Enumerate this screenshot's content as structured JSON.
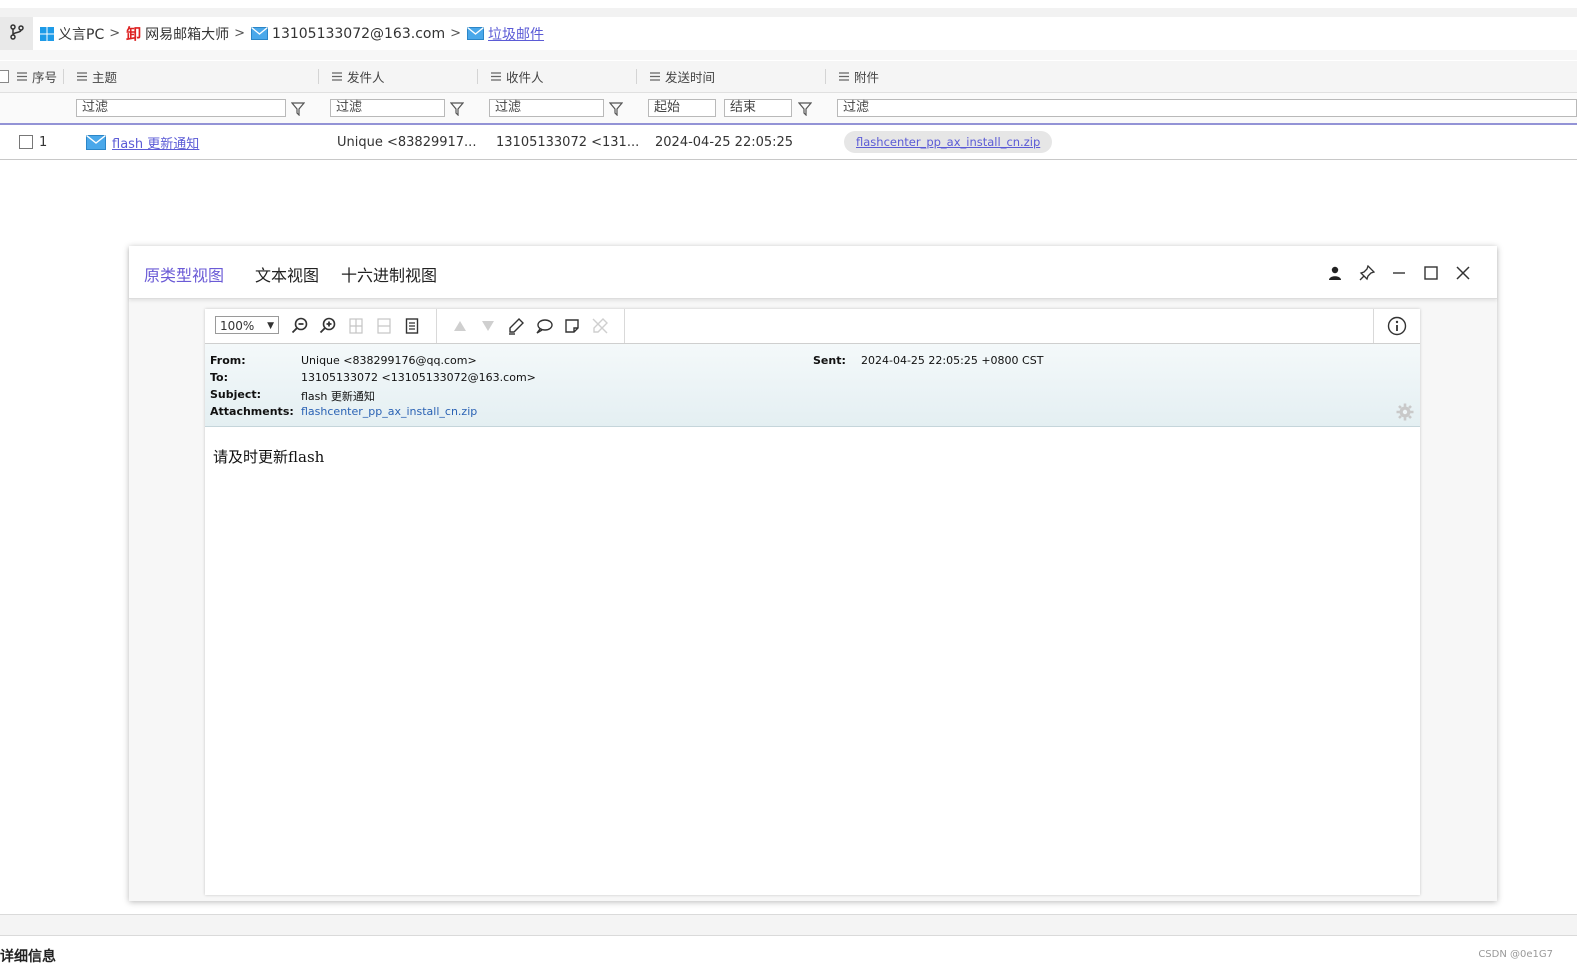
{
  "breadcrumb": {
    "items": [
      {
        "label": "义言PC",
        "icon": "windows-icon"
      },
      {
        "label": "网易邮箱大师",
        "icon": "mail-master-icon"
      },
      {
        "label": "13105133072@163.com",
        "icon": "envelope-icon"
      },
      {
        "label": "垃圾邮件",
        "icon": "envelope-icon"
      }
    ]
  },
  "grid": {
    "columns": [
      "序号",
      "主题",
      "发件人",
      "收件人",
      "发送时间",
      "附件"
    ],
    "filter_placeholders": {
      "subject": "过滤",
      "sender": "过滤",
      "recipient": "过滤",
      "time_start": "起始",
      "time_end": "结束",
      "attachment": "过滤"
    },
    "rows": [
      {
        "index": "1",
        "subject": "flash 更新通知",
        "sender": "Unique <83829917...",
        "recipient": "13105133072 <131...",
        "sent_time": "2024-04-25 22:05:25",
        "attachment": "flashcenter_pp_ax_install_cn.zip"
      }
    ]
  },
  "viewer": {
    "tabs": [
      "原类型视图",
      "文本视图",
      "十六进制视图"
    ],
    "active_tab": 0,
    "zoom": "100%",
    "header": {
      "from_label": "From:",
      "from_value": "Unique <838299176@qq.com>",
      "to_label": "To:",
      "to_value": "13105133072 <13105133072@163.com>",
      "subject_label": "Subject:",
      "subject_value": "flash 更新通知",
      "attachments_label": "Attachments:",
      "attachments_value": "flashcenter_pp_ax_install_cn.zip",
      "sent_label": "Sent:",
      "sent_value": "2024-04-25 22:05:25 +0800 CST"
    },
    "body_text": "请及时更新flash"
  },
  "footer": {
    "details_label": "详细信息",
    "watermark": "CSDN @0e1G7"
  },
  "colors": {
    "accent": "#6b5bd6",
    "link": "#5b5bd6",
    "header_bg": "#e9f3f5"
  }
}
